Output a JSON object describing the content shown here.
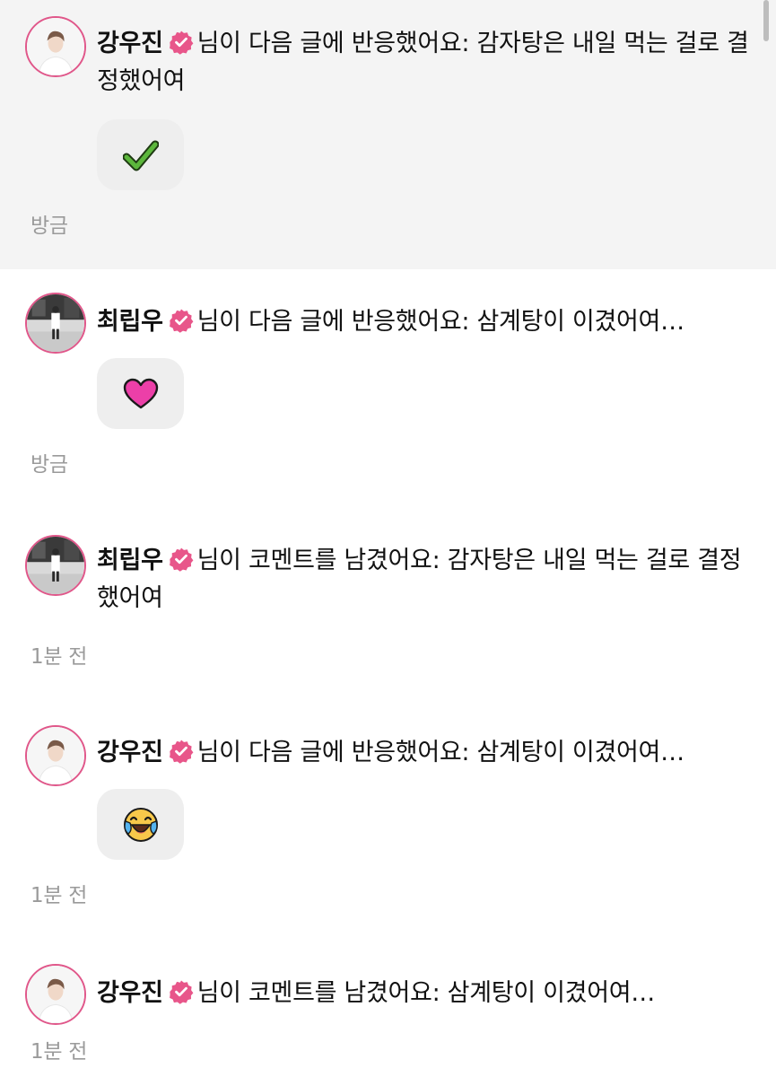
{
  "screen": {
    "notifications": [
      {
        "user": "강우진",
        "message": "님이 다음 글에 반응했어요: 감자탕은 내일 먹는 걸로 결정했어여",
        "reaction": "check-mark-icon",
        "time": "방금",
        "unread": true
      },
      {
        "user": "최립우",
        "message": "님이 다음 글에 반응했어요: 삼계탕이 이겼어여…",
        "reaction": "heart-icon",
        "time": "방금",
        "unread": false
      },
      {
        "user": "최립우",
        "message": "님이 코멘트를 남겼어요: 감자탕은 내일 먹는 걸로 결정했어여",
        "reaction": null,
        "time": "1분 전",
        "unread": false
      },
      {
        "user": "강우진",
        "message": "님이 다음 글에 반응했어요: 삼계탕이 이겼어여…",
        "reaction": "laughing-crying-face-icon",
        "time": "1분 전",
        "unread": false
      },
      {
        "user": "강우진",
        "message": "님이 코멘트를 남겼어요: 삼계탕이 이겼어여…",
        "reaction": null,
        "time": "1분 전",
        "unread": false
      }
    ]
  },
  "colors": {
    "avatar_ring": "#e0578a",
    "verified_badge": "#e8568a",
    "unread_background": "#f4f4f4",
    "timestamp": "#9a9a9a",
    "reaction_chip": "#eeeeee",
    "check_green": "#5cb73c",
    "heart_pink": "#ec3fa8",
    "emoji_yellow": "#f7c84a"
  }
}
